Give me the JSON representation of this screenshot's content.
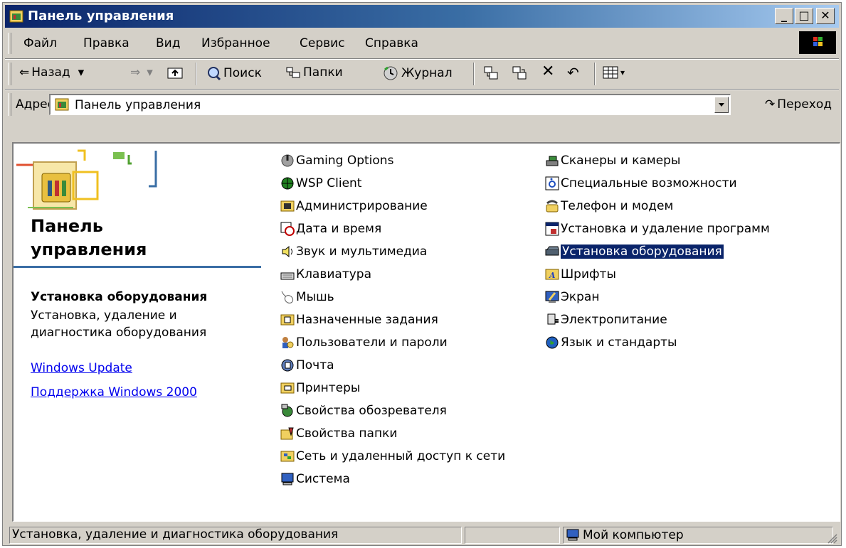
{
  "window": {
    "title": "Панель управления",
    "minimize": "_",
    "maximize": "□",
    "close": "✕"
  },
  "menu": [
    "Файл",
    "Правка",
    "Вид",
    "Избранное",
    "Сервис",
    "Справка"
  ],
  "toolbar": {
    "back": "Назад",
    "search": "Поиск",
    "folders": "Папки",
    "history": "Журнал"
  },
  "address": {
    "label": "Адрес",
    "value": "Панель управления",
    "go": "Переход"
  },
  "left_panel": {
    "title_line1": "Панель",
    "title_line2": "управления",
    "selected_heading": "Установка оборудования",
    "selected_desc": "Установка, удаление и диагностика оборудования",
    "link1": "Windows Update",
    "link2": "Поддержка Windows 2000"
  },
  "items_col1": [
    "Gaming Options",
    "WSP Client",
    "Администрирование",
    "Дата и время",
    "Звук и мультимедиа",
    "Клавиатура",
    "Мышь",
    "Назначенные задания",
    "Пользователи и пароли",
    "Почта",
    "Принтеры",
    "Свойства обозревателя",
    "Свойства папки",
    "Сеть и удаленный доступ к сети",
    "Система"
  ],
  "items_col2": [
    "Сканеры и камеры",
    "Специальные возможности",
    "Телефон и модем",
    "Установка и удаление программ",
    "Установка оборудования",
    "Шрифты",
    "Экран",
    "Электропитание",
    "Язык и стандарты"
  ],
  "selected_item": "Установка оборудования",
  "status": {
    "text": "Установка, удаление и диагностика оборудования",
    "zone": "Мой компьютер"
  },
  "colors": {
    "titlebar": "#0a246a",
    "face": "#d4d0c8",
    "selection": "#0a246a",
    "link": "#0000ee"
  }
}
